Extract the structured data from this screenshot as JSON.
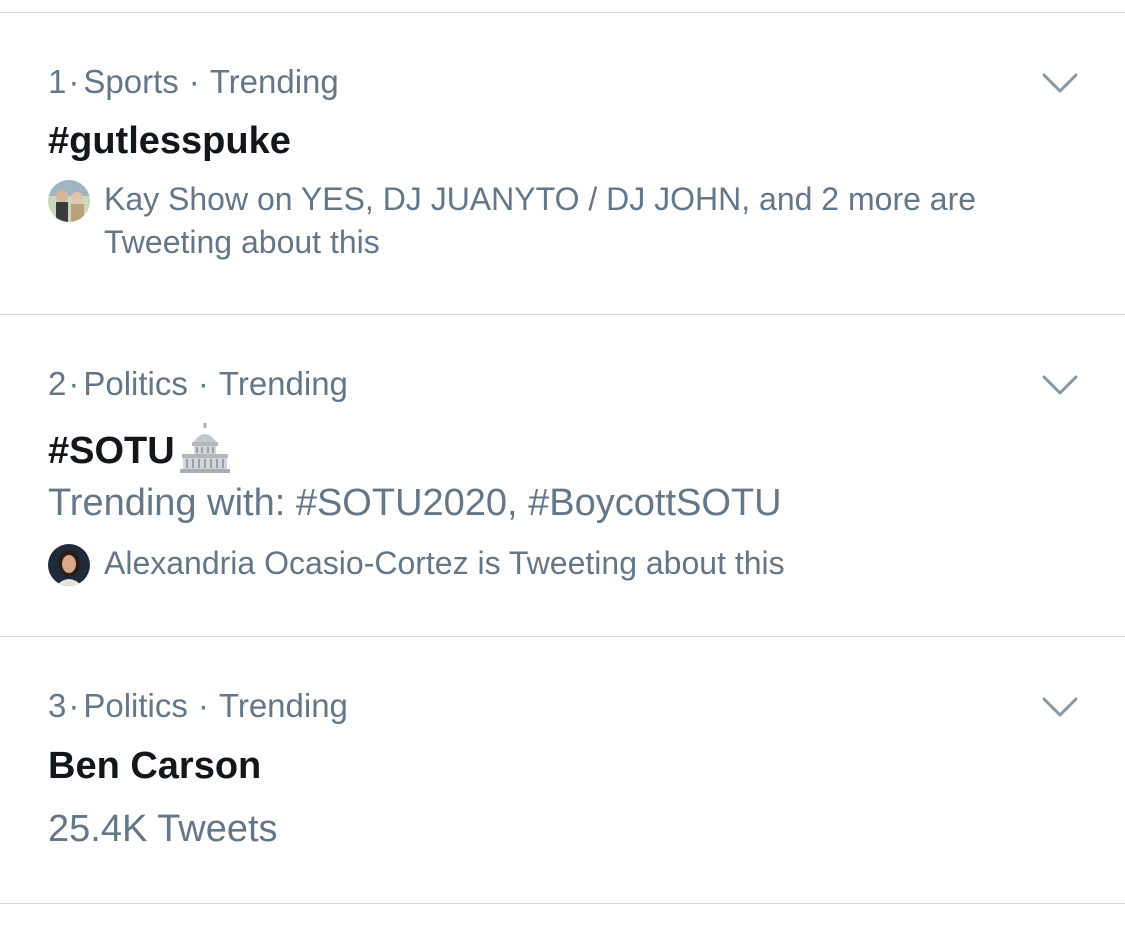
{
  "trends": [
    {
      "rank": "1",
      "category": "Sports",
      "status": "Trending",
      "title": "#gutlesspuke",
      "context": "Kay Show on YES, DJ JUANYTO / DJ JOHN, and 2 more are Tweeting about this"
    },
    {
      "rank": "2",
      "category": "Politics",
      "status": "Trending",
      "title": "#SOTU",
      "title_icon": "capitol-building-icon",
      "trending_with": "Trending with: #SOTU2020, #BoycottSOTU",
      "context": "Alexandria Ocasio-Cortez is Tweeting about this"
    },
    {
      "rank": "3",
      "category": "Politics",
      "status": "Trending",
      "title": "Ben Carson",
      "tweet_count": "25.4K Tweets"
    }
  ],
  "separator": "·",
  "colors": {
    "primary_text": "#14171a",
    "secondary_text": "#657786",
    "divider": "#d6d9dc",
    "chevron": "#8899a6"
  }
}
